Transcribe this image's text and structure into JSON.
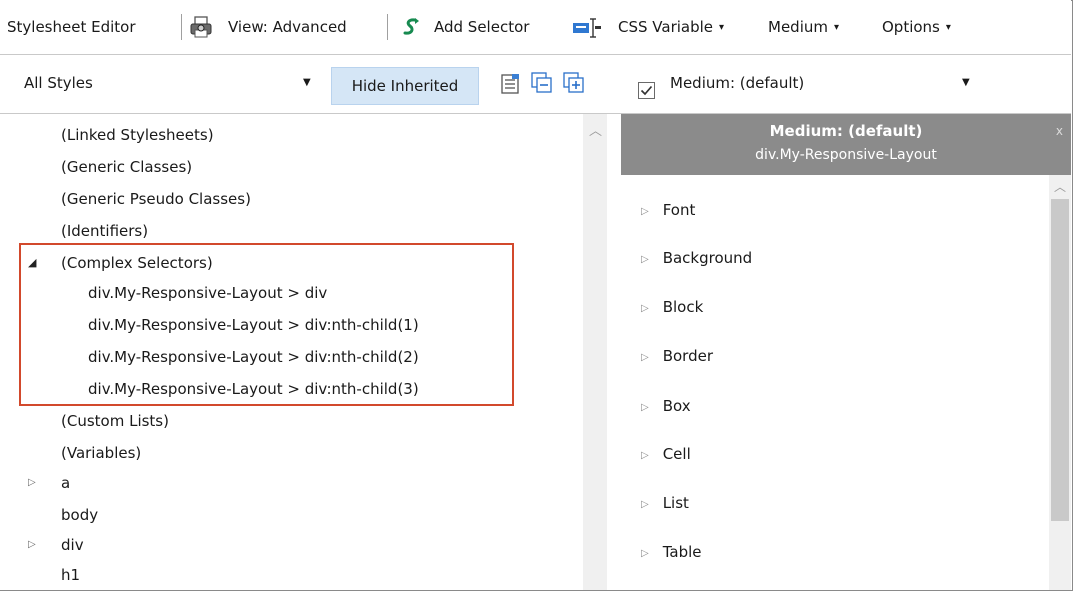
{
  "toolbar": {
    "title": "Stylesheet Editor",
    "view_label": "View: Advanced",
    "add_selector_label": "Add Selector",
    "css_variable_label": "CSS Variable",
    "medium_label": "Medium",
    "options_label": "Options",
    "caret": "▾"
  },
  "filters": {
    "styles_value": "All Styles",
    "hide_inherited_label": "Hide Inherited",
    "medium_value": "Medium: (default)",
    "dropdown_arrow": "▼",
    "medium_checked": true
  },
  "tree": {
    "items": [
      {
        "label": "(Linked Stylesheets)"
      },
      {
        "label": "(Generic Classes)"
      },
      {
        "label": "(Generic Pseudo Classes)"
      },
      {
        "label": "(Identifiers)"
      },
      {
        "label": "(Complex Selectors)",
        "expander": "◢"
      },
      {
        "label": "div.My-Responsive-Layout > div"
      },
      {
        "label": "div.My-Responsive-Layout > div:nth-child(1)"
      },
      {
        "label": "div.My-Responsive-Layout > div:nth-child(2)"
      },
      {
        "label": "div.My-Responsive-Layout > div:nth-child(3)"
      },
      {
        "label": "(Custom Lists)"
      },
      {
        "label": "(Variables)"
      },
      {
        "label": "a",
        "expander": "▷"
      },
      {
        "label": "body"
      },
      {
        "label": "div",
        "expander": "▷"
      },
      {
        "label": "h1"
      }
    ]
  },
  "panel": {
    "title": "Medium: (default)",
    "subtitle": "div.My-Responsive-Layout",
    "close": "x",
    "categories": [
      "Font",
      "Background",
      "Block",
      "Border",
      "Box",
      "Cell",
      "List",
      "Table"
    ],
    "triangle": "▷"
  },
  "colors": {
    "highlight": "#d2492c",
    "header_bg": "#8b8b8b",
    "toggle_bg": "#d5e6f6"
  },
  "icons": [
    "print-preview-icon",
    "add-selector-icon",
    "css-variable-icon",
    "view-icon",
    "collapse-icon",
    "expand-icon",
    "checkbox-icon",
    "expander-icon",
    "scroll-up-icon",
    "close-icon"
  ]
}
